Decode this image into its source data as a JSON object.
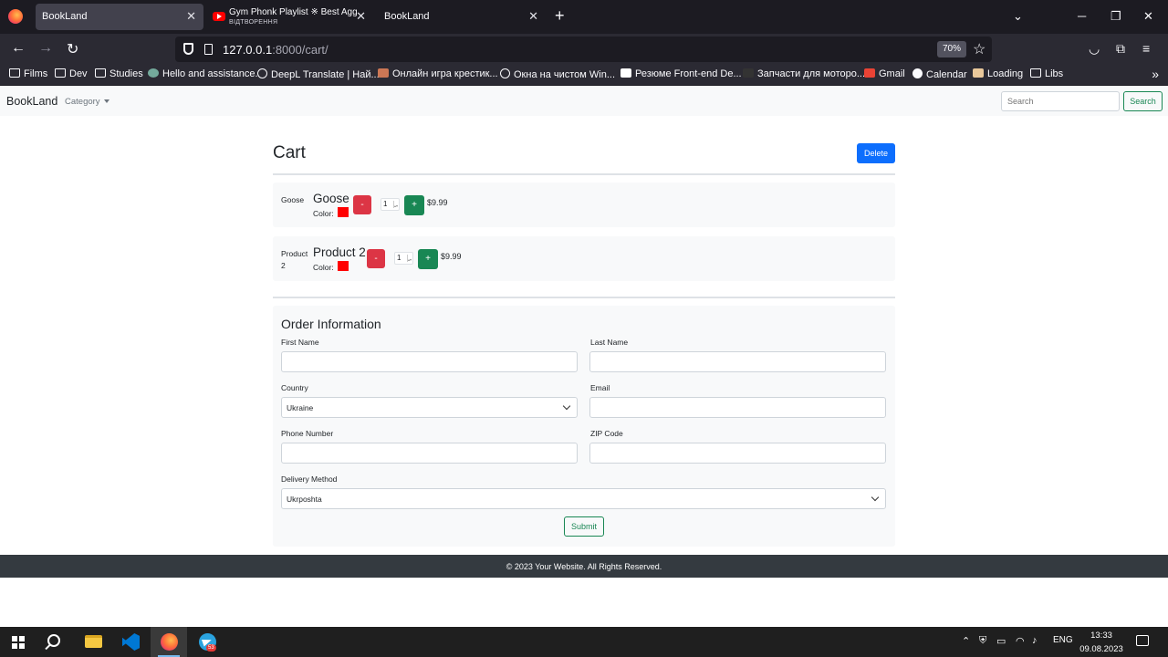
{
  "browser": {
    "tabs": [
      {
        "title": "BookLand",
        "active": true
      },
      {
        "title": "Gym Phonk Playlist ※ Best Aggr",
        "subtitle": "ВІДТВОРЕННЯ",
        "active": false
      },
      {
        "title": "BookLand",
        "active": false
      }
    ],
    "close_glyph": "✕",
    "new_tab_glyph": "+",
    "url_host": "127.0.0.1",
    "url_path": ":8000/cart/",
    "zoom": "70%",
    "bookmarks": [
      {
        "label": "Films",
        "icon": "folder-icon"
      },
      {
        "label": "Dev",
        "icon": "folder-icon"
      },
      {
        "label": "Studies",
        "icon": "folder-icon"
      },
      {
        "label": "Hello and assistance.",
        "icon": "chatgpt-icon"
      },
      {
        "label": "DeepL Translate | Най...",
        "icon": "globe-icon"
      },
      {
        "label": "Онлайн игра крестик...",
        "icon": "game-icon"
      },
      {
        "label": "Окна на чистом Win...",
        "icon": "globe-icon"
      },
      {
        "label": "Резюме Front-end De...",
        "icon": "dou-icon"
      },
      {
        "label": "Запчасти для мотоpo...",
        "icon": "moto-icon"
      },
      {
        "label": "Gmail",
        "icon": "gmail-icon"
      },
      {
        "label": "Calendar",
        "icon": "github-icon"
      },
      {
        "label": "Loading",
        "icon": "loading-icon"
      },
      {
        "label": "Libs",
        "icon": "folder-icon"
      }
    ]
  },
  "site": {
    "brand": "BookLand",
    "category": "Category",
    "search_placeholder": "Search",
    "search_button": "Search"
  },
  "cart": {
    "title": "Cart",
    "delete_label": "Delete",
    "minus_label": "-",
    "plus_label": "+",
    "color_label": "Color:",
    "items": [
      {
        "thumb": "Goose",
        "name": "Goose",
        "quantity": "1",
        "price": "$9.99",
        "color": "#ff0000"
      },
      {
        "thumb": "Product 2",
        "name": "Product 2",
        "quantity": "1",
        "price": "$9.99",
        "color": "#ff0000"
      }
    ]
  },
  "order": {
    "title": "Order Information",
    "first_name_label": "First Name",
    "last_name_label": "Last Name",
    "country_label": "Country",
    "country_value": "Ukraine",
    "email_label": "Email",
    "phone_label": "Phone Number",
    "zip_label": "ZIP Code",
    "delivery_label": "Delivery Method",
    "delivery_value": "Ukrposhta",
    "submit_label": "Submit"
  },
  "footer": {
    "text": "© 2023 Your Website. All Rights Reserved."
  },
  "taskbar": {
    "language": "ENG",
    "time": "13:33",
    "date": "09.08.2023",
    "telegram_badge": "53"
  },
  "colors": {
    "primary": "#0d6efd",
    "danger": "#dc3545",
    "success": "#198754",
    "footer": "#343a40"
  }
}
